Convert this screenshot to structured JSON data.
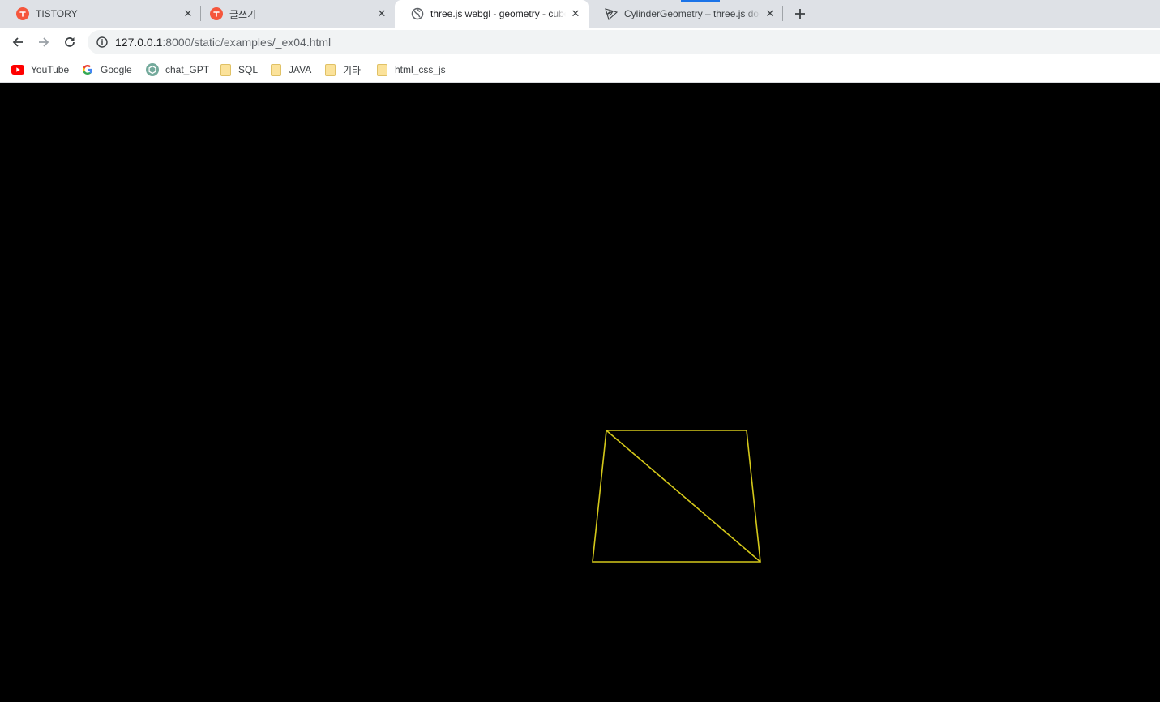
{
  "tabs": [
    {
      "title": "TISTORY",
      "icon": "tistory-icon",
      "active": false
    },
    {
      "title": "글쓰기",
      "icon": "tistory-icon",
      "active": false
    },
    {
      "title": "three.js webgl - geometry - cube",
      "icon": "globe-icon",
      "active": true
    },
    {
      "title": "CylinderGeometry – three.js docs",
      "icon": "threejs-icon",
      "active": false
    }
  ],
  "toolbar": {
    "url_host": "127.0.0.1",
    "url_rest": ":8000/static/examples/_ex04.html"
  },
  "bookmarks": [
    {
      "label": "YouTube",
      "icon": "youtube-icon"
    },
    {
      "label": "Google",
      "icon": "google-icon"
    },
    {
      "label": "chat_GPT",
      "icon": "chatgpt-icon"
    },
    {
      "label": "SQL",
      "icon": "folder-icon"
    },
    {
      "label": "JAVA",
      "icon": "folder-icon"
    },
    {
      "label": "기타",
      "icon": "folder-icon"
    },
    {
      "label": "html_css_js",
      "icon": "folder-icon"
    }
  ],
  "scene": {
    "background": "#000000",
    "wireframe_color": "#d4c81a"
  },
  "colors": {
    "tabstrip": "#dee1e6",
    "active_tab": "#ffffff",
    "tistory": "#f5563c",
    "accent": "#1a73e8"
  }
}
